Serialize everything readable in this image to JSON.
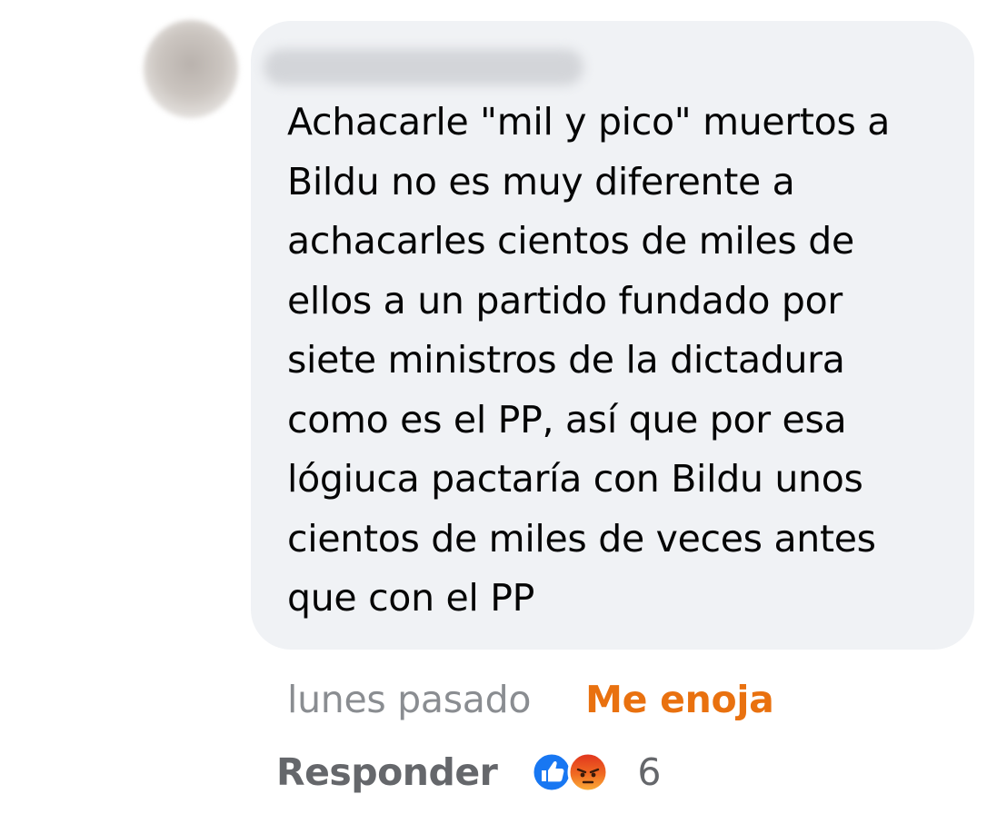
{
  "comment": {
    "author": "",
    "text_lines": [
      "Achacarle \"mil y pico\" muertos a",
      "Bildu no es muy diferente a",
      "achacarles cientos de miles de",
      "ellos a un partido fundado por",
      "siete ministros de la dictadura",
      "como es el PP, así que por esa",
      "lógiuca pactaría con Bildu unos",
      "cientos de miles de veces antes",
      "que con el PP"
    ],
    "timestamp": "lunes pasado",
    "user_reaction": "Me enoja",
    "reply_label": "Responder",
    "reaction_icons": [
      "like-icon",
      "angry-icon"
    ],
    "reaction_count": "6"
  },
  "colors": {
    "bubble_background": "#f0f2f5",
    "text": "#050505",
    "timestamp": "#8a8d91",
    "user_reaction": "#e9710f",
    "reply": "#65676b",
    "like_blue": "#1877f2",
    "angry_orange": "#f0541e"
  }
}
